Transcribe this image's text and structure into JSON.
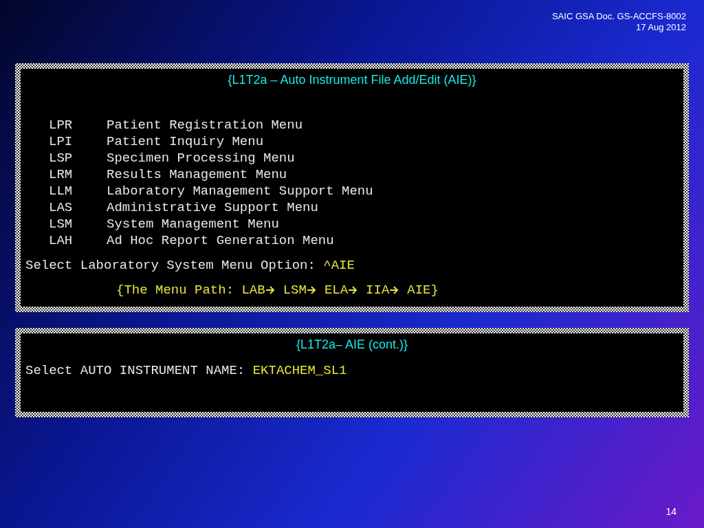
{
  "header": {
    "doc": "SAIC GSA Doc. GS-ACCFS-8002",
    "date": "17 Aug 2012"
  },
  "panels": [
    {
      "title": "{L1T2a – Auto Instrument File Add/Edit  (AIE)}",
      "menu": [
        {
          "code": "LPR",
          "label": "Patient Registration Menu"
        },
        {
          "code": "LPI",
          "label": "Patient Inquiry Menu"
        },
        {
          "code": "LSP",
          "label": "Specimen Processing Menu"
        },
        {
          "code": "LRM",
          "label": "Results Management Menu"
        },
        {
          "code": "LLM",
          "label": "Laboratory Management Support Menu"
        },
        {
          "code": "LAS",
          "label": "Administrative Support Menu"
        },
        {
          "code": "LSM",
          "label": "System Management Menu"
        },
        {
          "code": "LAH",
          "label": "Ad Hoc Report Generation Menu"
        }
      ],
      "prompt": {
        "label": "Select Laboratory System Menu Option:",
        "value": "^AIE"
      },
      "path": {
        "prefix": "{The Menu Path:",
        "steps": [
          "LAB",
          "LSM",
          "ELA",
          "IIA",
          "AIE}"
        ]
      }
    },
    {
      "title": "{L1T2a– AIE (cont.)}",
      "prompt": {
        "label": "Select AUTO INSTRUMENT NAME:",
        "value": "EKTACHEM_SL1"
      }
    }
  ],
  "page_number": "14"
}
